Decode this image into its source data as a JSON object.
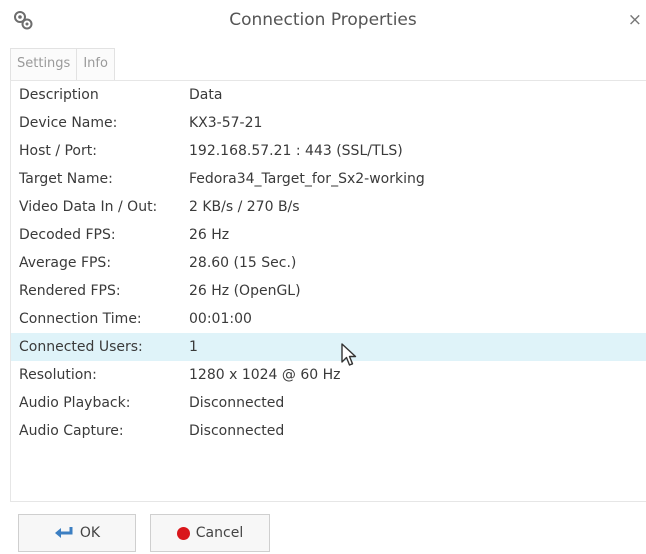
{
  "window": {
    "title": "Connection Properties",
    "close_glyph": "×"
  },
  "tabs": [
    {
      "label": "Settings"
    },
    {
      "label": "Info"
    }
  ],
  "table": {
    "headers": {
      "description": "Description",
      "data": "Data"
    },
    "rows": [
      {
        "label": "Device Name:",
        "value": "KX3-57-21"
      },
      {
        "label": "Host / Port:",
        "value": "192.168.57.21 : 443 (SSL/TLS)"
      },
      {
        "label": "Target Name:",
        "value": "Fedora34_Target_for_Sx2-working"
      },
      {
        "label": "Video Data In / Out:",
        "value": "2 KB/s / 270 B/s"
      },
      {
        "label": "Decoded FPS:",
        "value": "26 Hz"
      },
      {
        "label": "Average FPS:",
        "value": "28.60 (15 Sec.)"
      },
      {
        "label": "Rendered FPS:",
        "value": "26 Hz (OpenGL)"
      },
      {
        "label": "Connection Time:",
        "value": "00:01:00"
      },
      {
        "label": "Connected Users:",
        "value": "1"
      },
      {
        "label": "Resolution:",
        "value": "1280 x 1024 @ 60 Hz"
      },
      {
        "label": "Audio Playback:",
        "value": "Disconnected"
      },
      {
        "label": "Audio Capture:",
        "value": "Disconnected"
      }
    ]
  },
  "buttons": {
    "ok_label": "OK",
    "cancel_label": "Cancel"
  },
  "colors": {
    "selected_row": "#dff3f9",
    "ok_icon": "#3c7fc2",
    "cancel_icon": "#d9161b"
  },
  "icons": {
    "app": "gear-cluster-icon",
    "ok": "return-arrow-icon",
    "cancel": "red-circle-icon",
    "cursor": "mouse-pointer-icon"
  }
}
